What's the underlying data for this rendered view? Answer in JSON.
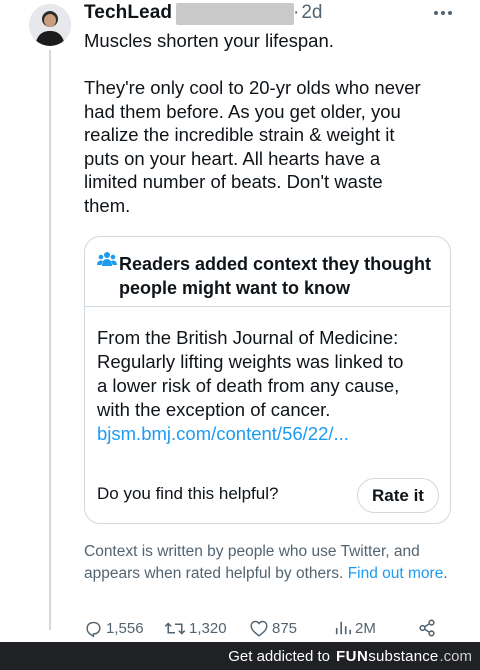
{
  "tweet": {
    "author_name": "TechLead",
    "time_ago": "2d",
    "text_lines": [
      "Muscles shorten your lifespan.",
      "They're only cool to 20-yr olds who never\nhad them before.  As you get older, you\nrealize the incredible strain & weight it\nputs on your heart.  All hearts have a\nlimited number of beats.  Don't waste\nthem."
    ]
  },
  "note": {
    "title": "Readers added context they thought people might want to know",
    "body": "From the British Journal of Medicine:\nRegularly lifting weights was linked to\na lower risk of death from any cause,\nwith the exception of cancer.",
    "link_text": "bjsm.bmj.com/content/56/22/...",
    "helpful_question": "Do you find this helpful?",
    "rate_label": "Rate it"
  },
  "context": {
    "text": "Context is written by people who use Twitter, and appears when rated helpful by others.",
    "link_text": "Find out more",
    "trailing": "."
  },
  "actions": {
    "replies": "1,556",
    "retweets": "1,320",
    "likes": "875",
    "views": "2M"
  },
  "watermark": {
    "text": "Get addicted to",
    "brand_fun": "FUN",
    "brand_sub": "substance",
    "brand_domain": ".com"
  },
  "colors": {
    "link": "#1d9bf0",
    "secondary_text": "#536471",
    "border": "#cfd9de",
    "watermark_bg": "#202124"
  },
  "icons": [
    "more-icon",
    "people-icon",
    "reply-icon",
    "retweet-icon",
    "like-icon",
    "views-icon",
    "share-icon"
  ]
}
